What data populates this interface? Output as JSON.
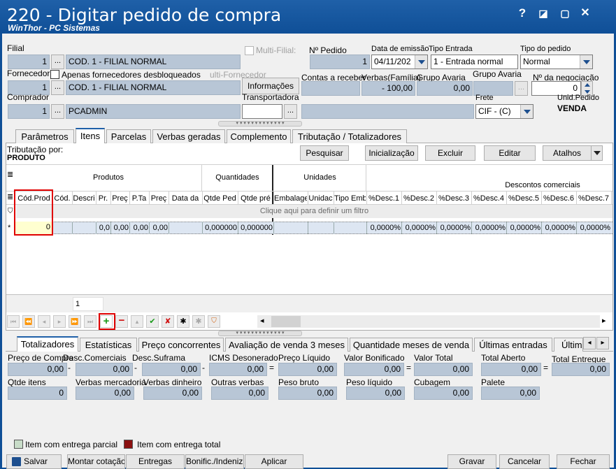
{
  "window": {
    "title": "220 - Digitar pedido de compra",
    "subtitle": "WinThor - PC Sistemas",
    "help_label": "?",
    "restore_label": "◪",
    "minimize_label": "▢",
    "close_label": "✕"
  },
  "header": {
    "filial_label": "Filial",
    "filial_code": "1",
    "filial_name": "COD. 1 - FILIAL NORMAL",
    "multi_filial_label": "Multi-Filial:",
    "no_pedido_label": "Nº Pedido",
    "no_pedido_value": "1",
    "data_emissao_label": "Data de emissão",
    "data_emissao_value": "04/11/202",
    "tipo_entrada_label": "Tipo Entrada",
    "tipo_entrada_value": "1 - Entrada normal",
    "tipo_pedido_label": "Tipo do pedido",
    "tipo_pedido_value": "Normal",
    "fornecedor_label": "Fornecedor",
    "apenas_label": "Apenas fornecedores desbloqueados",
    "multi_fornecedor_label": "ulti-Fornecedor",
    "fornecedor_code": "1",
    "fornecedor_name": "COD. 1 - FILIAL NORMAL",
    "informacoes_label": "Informações",
    "contas_label": "Contas a receber",
    "verbas_label": "Verbas(Família)",
    "verbas_value": "- 100,00",
    "grupo_avaria1_label": "Grupo Avaria",
    "grupo_avaria1_value": "0,00",
    "grupo_avaria2_label": "Grupo Avaria",
    "negociacao_label": "Nº da negociação",
    "negociacao_value": "0",
    "comprador_label": "Comprador",
    "comprador_code": "1",
    "comprador_name": "PCADMIN",
    "transportadora_label": "Transportadora",
    "frete_label": "Frete",
    "frete_value": "CIF - (C)",
    "unid_pedido_label": "Unid.Pedido",
    "unid_pedido_value": "VENDA",
    "dots_label": "..."
  },
  "tabs": [
    {
      "label": "Parâmetros"
    },
    {
      "label": "Itens"
    },
    {
      "label": "Parcelas"
    },
    {
      "label": "Verbas geradas"
    },
    {
      "label": "Complemento"
    },
    {
      "label": "Tributação / Totalizadores"
    }
  ],
  "itens": {
    "tributacao_label": "Tributação por:",
    "tributacao_value": "PRODUTO",
    "buttons": {
      "pesquisar": "Pesquisar",
      "inicializacao": "Inicialização",
      "excluir": "Excluir",
      "editar": "Editar",
      "atalhos": "Atalhos"
    },
    "groups": {
      "produtos": "Produtos",
      "quantidades": "Quantidades",
      "unidades": "Unidades",
      "descontos": "Descontos comerciais"
    },
    "columns": [
      "Cód.Prod",
      "Cód.",
      "Descri",
      "Pr.",
      "Preç",
      "P.Ta",
      "Preç",
      "Data da",
      "Qtde Ped",
      "Qtde pré",
      "Embalage",
      "Unidac",
      "Tipo Emb",
      "%Desc.1",
      "%Desc.2",
      "%Desc.3",
      "%Desc.4",
      "%Desc.5",
      "%Desc.6",
      "%Desc.7"
    ],
    "filter_hint": "Clique aqui para definir um filtro",
    "row": [
      "0",
      "",
      "",
      "0,0",
      "0,00",
      "0,00",
      "0,00",
      "",
      "0,000000",
      "0,000000",
      "",
      "",
      "",
      "0,0000%",
      "0,0000%",
      "0,0000%",
      "0,0000%",
      "0,0000%",
      "0,0000%",
      "0,0000%"
    ],
    "record_count": "1",
    "asterisk": "*"
  },
  "bottom_tabs": [
    {
      "label": "Totalizadores"
    },
    {
      "label": "Estatísticas"
    },
    {
      "label": "Preço concorrentes"
    },
    {
      "label": "Avaliação de venda 3 meses"
    },
    {
      "label": "Quantidade meses de venda"
    },
    {
      "label": "Últimas entradas"
    },
    {
      "label": "Últim"
    }
  ],
  "totals_row1": [
    {
      "label": "Preço de Compra",
      "value": "0,00"
    },
    {
      "label": "Desc.Comerciais",
      "value": "0,00"
    },
    {
      "label": "Desc.Suframa",
      "value": "0,00"
    },
    {
      "label": "ICMS Desonerado",
      "value": "0,00"
    },
    {
      "label": "Preço Líquido",
      "value": "0,00"
    },
    {
      "label": "Valor Bonificado",
      "value": "0,00"
    },
    {
      "label": "Valor Total",
      "value": "0,00"
    },
    {
      "label": "Total Aberto",
      "value": "0,00"
    },
    {
      "label": "Total Entregue",
      "value": "0,00"
    }
  ],
  "totals_row2": [
    {
      "label": "Qtde itens",
      "value": "0"
    },
    {
      "label": "Verbas mercadoria",
      "value": "0,00"
    },
    {
      "label": "Verbas dinheiro",
      "value": "0,00"
    },
    {
      "label": "Outras verbas",
      "value": "0,00"
    },
    {
      "label": "Peso bruto",
      "value": "0,00"
    },
    {
      "label": "Peso líquido",
      "value": "0,00"
    },
    {
      "label": "Cubagem",
      "value": "0,00"
    },
    {
      "label": "Palete",
      "value": "0,00"
    }
  ],
  "legend": {
    "parcial": "Item com entrega parcial",
    "total": "Item com entrega total",
    "parcial_color": "#c8dcc8",
    "total_color": "#8b1010"
  },
  "footer": {
    "salvar": "Salvar",
    "montar": "Montar cotação",
    "entregas": "Entregas",
    "bonific": "Bonific./Indeniz.",
    "aplicar": "Aplicar",
    "gravar": "Gravar",
    "cancelar": "Cancelar",
    "fechar": "Fechar"
  }
}
